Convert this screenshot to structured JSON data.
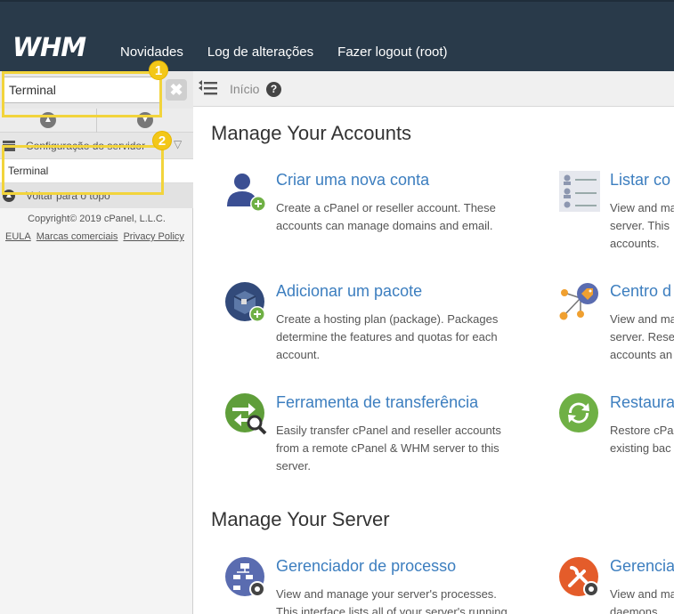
{
  "header": {
    "logo": "WHM",
    "nav": [
      "Novidades",
      "Log de alterações",
      "Fazer logout (root)"
    ]
  },
  "subbar": {
    "breadcrumb": "Início",
    "help": "?"
  },
  "sidebar": {
    "search_value": "Terminal",
    "clear_label": "✖",
    "category": "Configuração do servidor",
    "result": "Terminal",
    "back_to_top": "Voltar para o topo",
    "copyright": "Copyright© 2019 cPanel, L.L.C.",
    "links": [
      "EULA",
      "Marcas comerciais",
      "Privacy Policy"
    ]
  },
  "annotations": {
    "badge1": "1",
    "badge2": "2",
    "color": "#f2d43c"
  },
  "sections": {
    "accounts": "Manage Your Accounts",
    "server": "Manage Your Server"
  },
  "tiles": {
    "criar": {
      "title": "Criar uma nova conta",
      "desc": "Create a cPanel or reseller account. These accounts can manage domains and email.",
      "icon": "add-user-icon"
    },
    "listar": {
      "title": "Listar co",
      "desc": "View and ma\nserver. This\naccounts.",
      "icon": "list-accounts-icon"
    },
    "pacote": {
      "title": "Adicionar um pacote",
      "desc": "Create a hosting plan (package). Packages determine the features and quotas for each account.",
      "icon": "add-package-icon"
    },
    "centro": {
      "title": "Centro d",
      "desc": "View and ma\nserver. Rese\naccounts an",
      "icon": "reseller-center-icon"
    },
    "transfer": {
      "title": "Ferramenta de transferência",
      "desc": "Easily transfer cPanel and reseller accounts from a remote cPanel & WHM server to this server.",
      "icon": "transfer-tool-icon"
    },
    "restaura": {
      "title": "Restaura",
      "desc": "Restore cPa\nexisting bac",
      "icon": "restore-icon"
    },
    "processo": {
      "title": "Gerenciador de processo",
      "desc": "View and manage your server's processes. This interface lists all of your server's running",
      "icon": "process-manager-icon"
    },
    "gerencia": {
      "title": "Gerencia",
      "desc": "View and ma\ndaemons",
      "icon": "service-manager-icon"
    }
  }
}
